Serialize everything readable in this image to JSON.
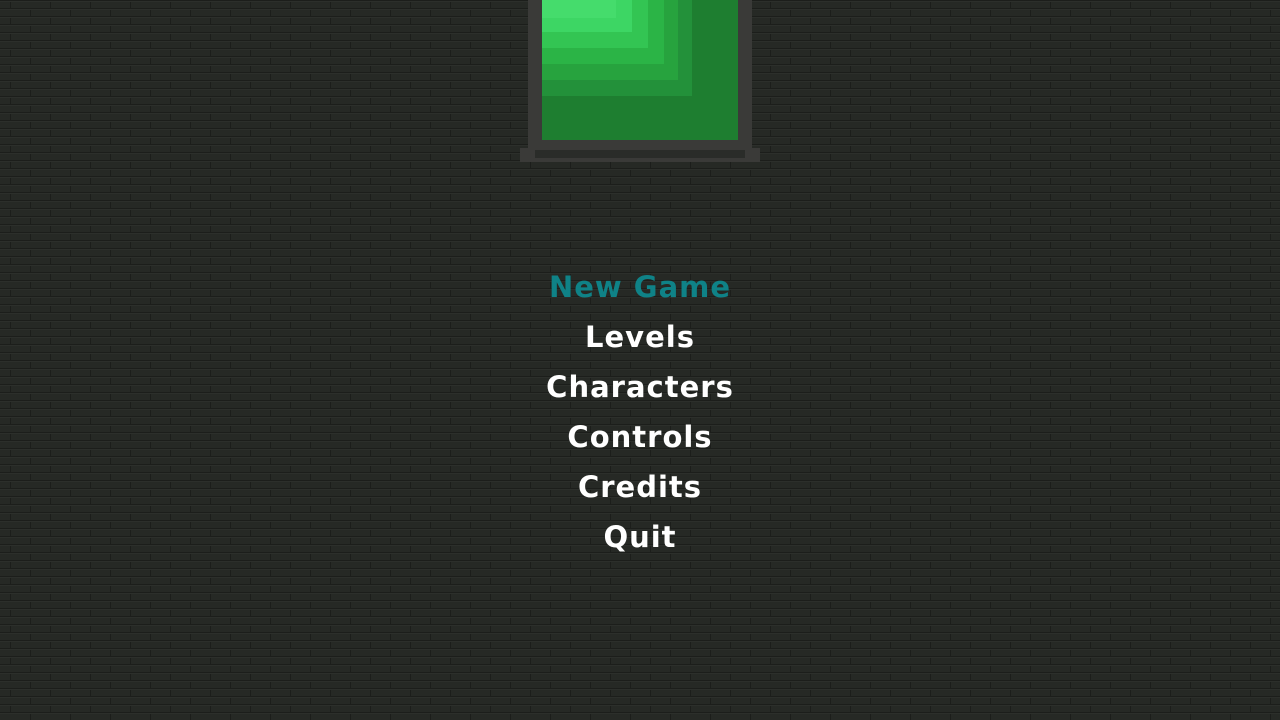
{
  "colors": {
    "background": "#262925",
    "brick_line": "#1d1f1c",
    "frame": "#3a3a38",
    "pane_dark": "#1e7e30",
    "pane_mid": "#27a33e",
    "pane_light": "#3dd664",
    "menu_text": "#ffffff",
    "menu_selected": "#0f8287"
  },
  "banner": {
    "icon": "green-banner-icon"
  },
  "menu": {
    "selected_index": 0,
    "items": [
      {
        "label": "New Game"
      },
      {
        "label": "Levels"
      },
      {
        "label": "Characters"
      },
      {
        "label": "Controls"
      },
      {
        "label": "Credits"
      },
      {
        "label": "Quit"
      }
    ]
  }
}
